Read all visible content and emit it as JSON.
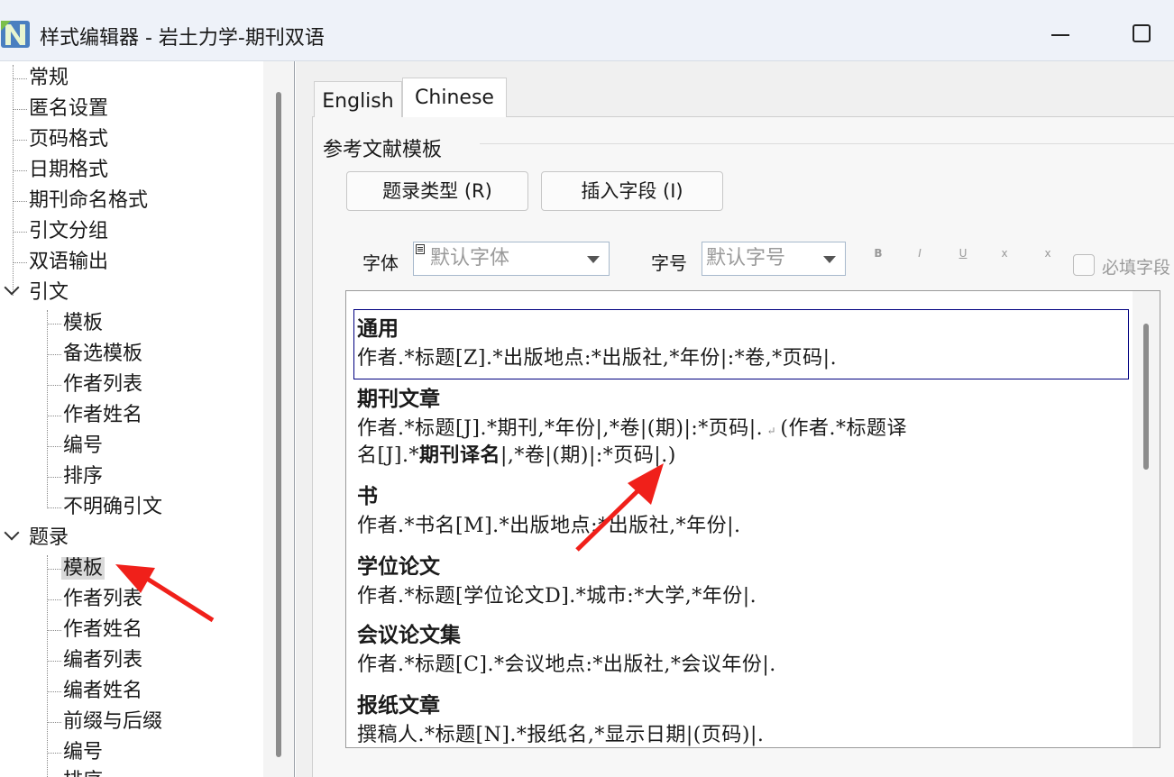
{
  "window": {
    "title": "样式编辑器 - 岩土力学-期刊双语"
  },
  "tree": {
    "items": [
      {
        "label": "常规"
      },
      {
        "label": "匿名设置"
      },
      {
        "label": "页码格式"
      },
      {
        "label": "日期格式"
      },
      {
        "label": "期刊命名格式"
      },
      {
        "label": "引文分组"
      },
      {
        "label": "双语输出"
      },
      {
        "label": "引文"
      },
      {
        "label": "模板"
      },
      {
        "label": "备选模板"
      },
      {
        "label": "作者列表"
      },
      {
        "label": "作者姓名"
      },
      {
        "label": "编号"
      },
      {
        "label": "排序"
      },
      {
        "label": "不明确引文"
      },
      {
        "label": "题录"
      },
      {
        "label": "模板"
      },
      {
        "label": "作者列表"
      },
      {
        "label": "作者姓名"
      },
      {
        "label": "编者列表"
      },
      {
        "label": "编者姓名"
      },
      {
        "label": "前缀与后缀"
      },
      {
        "label": "编号"
      },
      {
        "label": "排序"
      }
    ]
  },
  "tabs": [
    {
      "label": "English"
    },
    {
      "label": "Chinese"
    }
  ],
  "group": {
    "title": "参考文献模板"
  },
  "buttons": {
    "ref_type": "题录类型 (R)",
    "insert_field": "插入字段 (I)"
  },
  "format": {
    "font_label": "字体",
    "font_value": "默认字体",
    "size_label": "字号",
    "size_value": "默认字号",
    "bold": "B",
    "italic": "I",
    "underline": "U",
    "superscript": "x",
    "subscript": "x",
    "required_label": "必填字段"
  },
  "templates": [
    {
      "title": "通用",
      "line1": "作者.*标题[Z].*出版地点:*出版社,*年份|:*卷,*页码|."
    },
    {
      "title": "期刊文章",
      "line1a": "作者.*标题[J].*期刊,*年份|,*卷|(期)|:*页码|.",
      "line1b": "(作者.*标题译",
      "line2a": "名[J].*",
      "line2b": "期刊译名",
      "line2c": "|,*卷|(期)|:*页码|.)"
    },
    {
      "title": "书",
      "line1": "作者.*书名[M].*出版地点:*出版社,*年份|."
    },
    {
      "title": "学位论文",
      "line1": "作者.*标题[学位论文D].*城市:*大学,*年份|."
    },
    {
      "title": "会议论文集",
      "line1": "作者.*标题[C].*会议地点:*出版社,*会议年份|."
    },
    {
      "title": "报纸文章",
      "line1": "撰稿人.*标题[N].*报纸名,*显示日期|(页码)|."
    }
  ],
  "colors": {
    "arrow": "#f0201a",
    "selection_border": "#000080"
  }
}
